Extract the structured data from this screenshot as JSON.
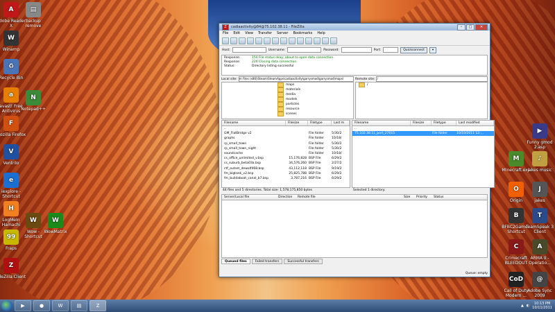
{
  "desktop_icons_left": [
    {
      "label": "Adobe Reader X",
      "glyph": "A",
      "color": "#c01818"
    },
    {
      "label": "Winamp",
      "glyph": "W",
      "color": "#333"
    },
    {
      "label": "Recycle Bin",
      "glyph": "♻",
      "color": "#4a74b8"
    },
    {
      "label": "avast! Free Antivirus",
      "glyph": "a",
      "color": "#e67e00"
    },
    {
      "label": "Mozilla Firefox",
      "glyph": "F",
      "color": "#d05010"
    },
    {
      "label": "Ventrilo",
      "glyph": "V",
      "color": "#2050a0"
    },
    {
      "label": "iexplore - Shortcut",
      "glyph": "e",
      "color": "#1a6fd0"
    },
    {
      "label": "LogMeIn Hamachi",
      "glyph": "H",
      "color": "#f08020"
    },
    {
      "label": "Fraps",
      "glyph": "99",
      "color": "#c8b800"
    },
    {
      "label": "FileZilla Client",
      "glyph": "Z",
      "color": "#b01010"
    }
  ],
  "desktop_icons_left2": [
    {
      "label": "backup remove",
      "glyph": "▤",
      "color": "#888"
    },
    {
      "label": "Notepad++",
      "glyph": "N",
      "color": "#3a8a3a"
    },
    {
      "label": "Wow - Shortcut",
      "glyph": "W",
      "color": "#6a4a10"
    },
    {
      "label": "WowMatrix",
      "glyph": "W",
      "color": "#1a8a1a"
    }
  ],
  "desktop_icons_right": [
    {
      "label": "Funny gmod 2.asp",
      "glyph": "▶",
      "color": "#3a3a8a"
    },
    {
      "label": "Minecraft.exe",
      "glyph": "M",
      "color": "#4a8a2a"
    },
    {
      "label": "jakes music",
      "glyph": "♪",
      "color": "#c0a040"
    },
    {
      "label": "Origin",
      "glyph": "O",
      "color": "#f06000"
    },
    {
      "label": "jakes",
      "glyph": "J",
      "color": "#555"
    },
    {
      "label": "BFBC2Game - Shortcut",
      "glyph": "B",
      "color": "#333"
    },
    {
      "label": "TeamSpeak 3 Client",
      "glyph": "T",
      "color": "#2a4a8a"
    },
    {
      "label": "Crimecraft BLEEDOUT",
      "glyph": "C",
      "color": "#8a1a1a"
    },
    {
      "label": "ARMA II - Operatio...",
      "glyph": "A",
      "color": "#4a4a2a"
    },
    {
      "label": "Call of Duty Modern ...",
      "glyph": "CoD",
      "color": "#222"
    },
    {
      "label": "Adobe Sync 2009",
      "glyph": "@",
      "color": "#444"
    }
  ],
  "window": {
    "title": "cadiaactivity@84@75.102.38.11 - FileZilla",
    "menu": [
      "File",
      "Edit",
      "View",
      "Transfer",
      "Server",
      "Bookmarks",
      "Help"
    ],
    "quickconnect": {
      "host_label": "Host:",
      "user_label": "Username:",
      "pass_label": "Password:",
      "port_label": "Port:",
      "button": "Quickconnect"
    },
    "log": [
      {
        "k": "Response:",
        "v": "150 File status okay; about to open data connection."
      },
      {
        "k": "Response:",
        "v": "226 Closing data connection."
      },
      {
        "k": "Status:",
        "v": "Directory listing successful"
      }
    ],
    "local_site_label": "Local site:",
    "local_site_path": "m Files (x86)\\Steam\\SteamApps\\cadiaactivity\\garrysmod\\garrysmod\\maps\\",
    "remote_site_label": "Remote site:",
    "remote_site_path": "/",
    "local_tree": [
      "maps",
      "materials",
      "media",
      "models",
      "particles",
      "resource",
      "scenes"
    ],
    "remote_tree": [
      "/"
    ],
    "local_headers": [
      "Filename",
      "Filesize",
      "Filetype",
      "Last m"
    ],
    "remote_headers": [
      "Filename",
      "Filesize",
      "Filetype",
      "Last modified"
    ],
    "local_files": [
      [
        "..",
        "",
        "",
        ""
      ],
      [
        "GM_FlatBridge v2",
        "",
        "File folder",
        "5/30/2"
      ],
      [
        "graphs",
        "",
        "File folder",
        "10/18/"
      ],
      [
        "rp_small_town",
        "",
        "File folder",
        "5/30/2"
      ],
      [
        "rp_small_town_night",
        "",
        "File folder",
        "5/30/2"
      ],
      [
        "soundcache",
        "",
        "File folder",
        "10/18/"
      ],
      [
        "cs_office_unlimited_v.bsp",
        "15,176,828",
        "BSP File",
        "6/29/2"
      ],
      [
        "cs_suburb_beta03a.bsp",
        "34,576,260",
        "BSP File",
        "2/27/2"
      ],
      [
        "ctf_outset_dewolf468.bsp",
        "43,112,118",
        "BSP File",
        "9/19/2"
      ],
      [
        "fm_bigtank_v2.bsp",
        "25,825,788",
        "BSP File",
        "6/29/2"
      ],
      [
        "fm_buildaboat_canal_b7.bsp",
        "3,787,216",
        "BSP File",
        "6/29/2"
      ]
    ],
    "remote_files": [
      [
        "..",
        "",
        "",
        ""
      ],
      [
        "75.102.38.11_port_27015",
        "",
        "File folder",
        "10/10/2011 12:..."
      ]
    ],
    "local_status": "44 files and 5 directories. Total size: 1,578,175,850 bytes",
    "remote_status": "Selected 1 directory.",
    "queue_headers": [
      "Server/Local file",
      "Direction",
      "Remote file",
      "Size",
      "Priority",
      "Status"
    ],
    "queue_tabs": [
      "Queued files",
      "Failed transfers",
      "Successful transfers"
    ],
    "queue_status": "Queue: empty"
  },
  "taskbar": {
    "time": "10:13 PM",
    "date": "10/11/2011"
  }
}
